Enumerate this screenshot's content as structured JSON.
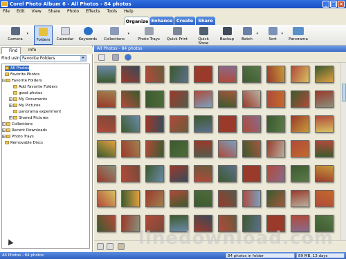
{
  "window": {
    "title": "Corel Photo Album 6 - All Photos - 84 photos"
  },
  "menu": [
    "File",
    "Edit",
    "View",
    "Share",
    "Photo",
    "Effects",
    "Tools",
    "Help"
  ],
  "primary_tabs": [
    "Organize",
    "Enhance",
    "Create",
    "Share"
  ],
  "toolbar": [
    "Camera",
    "Folders",
    "Calendar",
    "Keywords",
    "Collections",
    "Photo Trays",
    "Quick Print",
    "Quick Show",
    "Backup",
    "Batch",
    "Sort",
    "Panorama"
  ],
  "left": {
    "tabs": [
      "Find",
      "Info"
    ],
    "find_using_label": "Find using:",
    "find_using_value": "Favorite Folders",
    "tree": [
      "All Photos",
      "Favorite Photos",
      "Favorite Folders",
      "Add Favorite Folders",
      "good photos",
      "My Documents",
      "My Pictures",
      "panorama experiment",
      "Shared Pictures",
      "Collections",
      "Recent Downloads",
      "Photo Trays",
      "Removable Discs"
    ]
  },
  "photos_header": "All Photos - 84 photos",
  "status": {
    "left": "All Photos - 84 photos",
    "count": "84 photos in folder",
    "disk": "89 MB, 13 days"
  },
  "watermark": "linedownload.com",
  "colors": {
    "accent": "#316ac5",
    "title": "#2f6fe0",
    "status": "#2f5fc0"
  }
}
